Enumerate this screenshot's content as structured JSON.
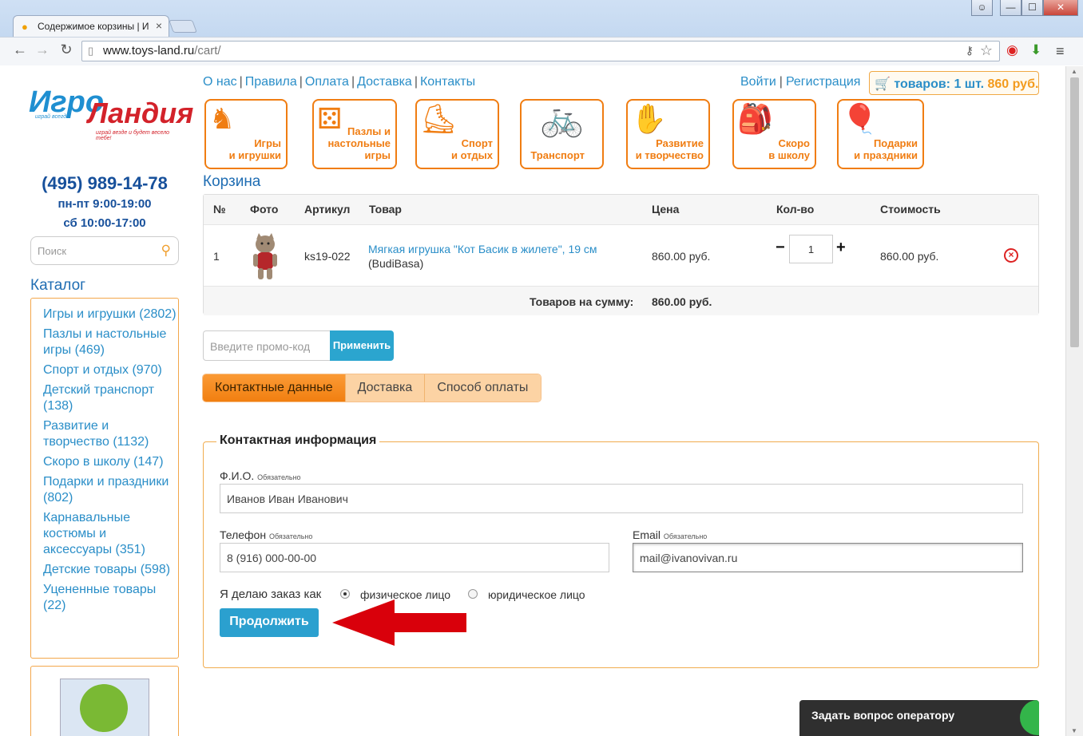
{
  "browser": {
    "tab_title": "Содержимое корзины | И",
    "url_host": "www.toys-land.ru",
    "url_path": "/cart/",
    "window_buttons": [
      "⊖",
      "—",
      "☐",
      "✕"
    ]
  },
  "logo": {
    "part1": "Игро",
    "part2": "Ландия",
    "tagline_left": "играй всегда",
    "tagline": "играй везде и будет весело тебе!"
  },
  "contact": {
    "phone": "(495) 989-14-78",
    "hours_weekday": "пн-пт 9:00-19:00",
    "hours_sat": "сб 10:00-17:00"
  },
  "search": {
    "placeholder": "Поиск"
  },
  "catalog": {
    "title": "Каталог",
    "items": [
      "Игры и игрушки (2802)",
      "Пазлы и настольные игры (469)",
      "Спорт и отдых (970)",
      "Детский транспорт (138)",
      "Развитие и творчество (1132)",
      "Скоро в школу (147)",
      "Подарки и праздники (802)",
      "Карнавальные костюмы и аксессуары (351)",
      "Детские товары (598)",
      "Уцененные товары (22)"
    ]
  },
  "topnav": [
    "О нас",
    "Правила",
    "Оплата",
    "Доставка",
    "Контакты"
  ],
  "auth": {
    "login": "Войти",
    "register": "Регистрация"
  },
  "cart_button": {
    "label": "товаров: 1 шт.",
    "price": "860 руб."
  },
  "categories": [
    {
      "line1": "Игры",
      "line2": "и игрушки"
    },
    {
      "line1": "Пазлы и",
      "line2": "настольные игры"
    },
    {
      "line1": "Спорт",
      "line2": "и отдых"
    },
    {
      "line1": "",
      "line2": "Транспорт"
    },
    {
      "line1": "Развитие",
      "line2": "и творчество"
    },
    {
      "line1": "Скоро",
      "line2": "в школу"
    },
    {
      "line1": "Подарки",
      "line2": "и праздники"
    }
  ],
  "page_title": "Корзина",
  "cart": {
    "headers": {
      "num": "№",
      "photo": "Фото",
      "sku": "Артикул",
      "product": "Товар",
      "price": "Цена",
      "qty": "Кол-во",
      "cost": "Стоимость"
    },
    "row": {
      "num": "1",
      "sku": "ks19-022",
      "product": "Мягкая игрушка \"Кот Басик в жилете\", 19 см",
      "brand": "(BudiBasa)",
      "price": "860.00 руб.",
      "qty": "1",
      "cost": "860.00 руб."
    },
    "total_label": "Товаров на сумму:",
    "total_value": "860.00 руб."
  },
  "promo": {
    "placeholder": "Введите промо-код",
    "apply": "Применить"
  },
  "steps": [
    "Контактные данные",
    "Доставка",
    "Способ оплаты"
  ],
  "form": {
    "legend": "Контактная информация",
    "required": "Обязательно",
    "name_label": "Ф.И.О.",
    "name_value": "Иванов Иван Иванович",
    "phone_label": "Телефон",
    "phone_value": "8 (916) 000-00-00",
    "email_label": "Email",
    "email_value": "mail@ivanovivan.ru",
    "order_as": "Я делаю заказ как",
    "individual": "физическое лицо",
    "legal": "юридическое лицо",
    "continue": "Продолжить"
  },
  "chat": {
    "label": "Задать вопрос оператору"
  },
  "colors": {
    "accent_orange": "#f07d12",
    "link_blue": "#2a8ec8",
    "button_blue": "#2ba0cf",
    "arrow_red": "#d9000b"
  }
}
